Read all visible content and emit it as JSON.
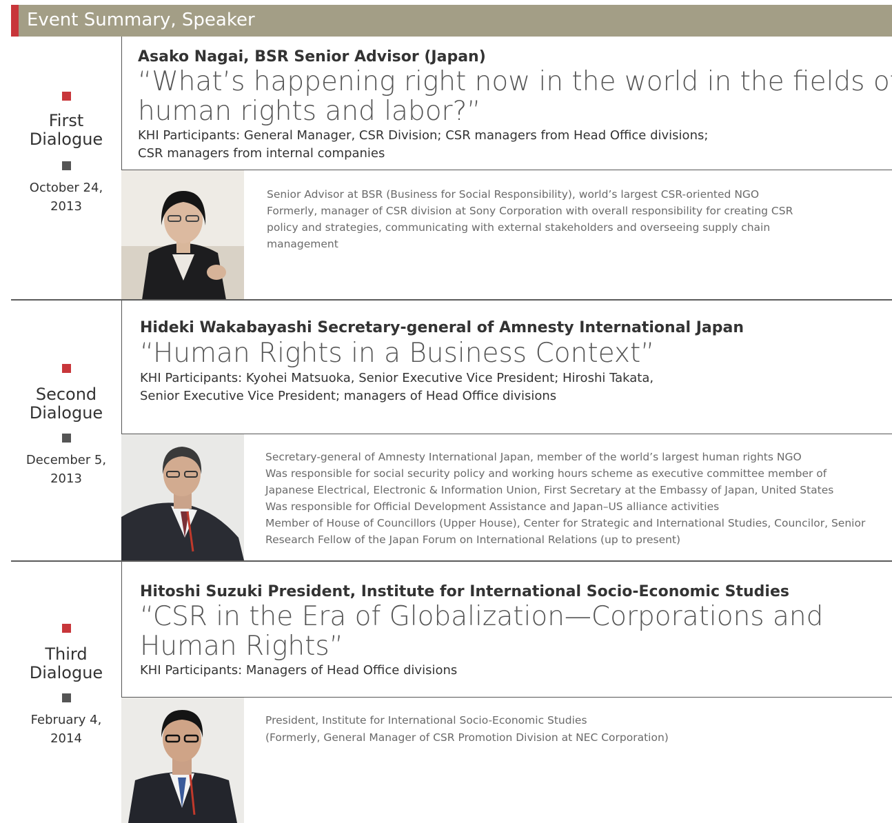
{
  "header": {
    "title": "Event Summary, Speaker"
  },
  "dialogues": [
    {
      "label": "First\nDialogue",
      "date": "October 24,\n2013",
      "speaker": "Asako Nagai, BSR Senior Advisor (Japan)",
      "talk_line1": "“What’s happening right now in the world in the fields of",
      "talk_line2": "human rights and labor?”",
      "participants_line1": "KHI Participants: General Manager, CSR Division; CSR managers from Head Office divisions;",
      "participants_line2": "CSR managers from internal companies",
      "bio": [
        "Senior Advisor at BSR (Business for Social Responsibility), world’s largest CSR-oriented NGO",
        "Formerly, manager of CSR division at Sony Corporation with overall responsibility for creating CSR",
        "policy and strategies, communicating with external stakeholders and overseeing supply chain",
        "management"
      ]
    },
    {
      "label": "Second\nDialogue",
      "date": "December 5,\n2013",
      "speaker": "Hideki Wakabayashi  Secretary-general of Amnesty International Japan",
      "talk_line1": "“Human Rights in a Business Context”",
      "talk_line2": "",
      "participants_line1": "KHI Participants: Kyohei Matsuoka, Senior Executive Vice President; Hiroshi Takata,",
      "participants_line2": "Senior Executive Vice President; managers of Head Office divisions",
      "bio": [
        "Secretary-general of Amnesty International Japan, member of the world’s largest human rights NGO",
        "Was responsible for social security policy and working hours scheme as executive committee member of",
        "Japanese Electrical, Electronic & Information Union, First Secretary at the Embassy of Japan, United States",
        "Was responsible for Official Development Assistance and Japan–US alliance activities",
        "Member of House of Councillors (Upper House), Center for Strategic and International Studies, Councilor, Senior",
        "Research Fellow of the Japan Forum on International Relations (up to present)"
      ]
    },
    {
      "label": "Third\nDialogue",
      "date": "February 4,\n2014",
      "speaker": "Hitoshi Suzuki  President, Institute for International Socio-Economic Studies",
      "talk_line1": "“CSR in the Era of Globalization—Corporations and",
      "talk_line2": "Human Rights”",
      "participants_line1": "KHI Participants: Managers of Head Office divisions",
      "participants_line2": "",
      "bio": [
        "President, Institute for International Socio-Economic Studies",
        "(Formerly, General Manager of CSR Promotion Division at NEC Corporation)"
      ]
    }
  ]
}
